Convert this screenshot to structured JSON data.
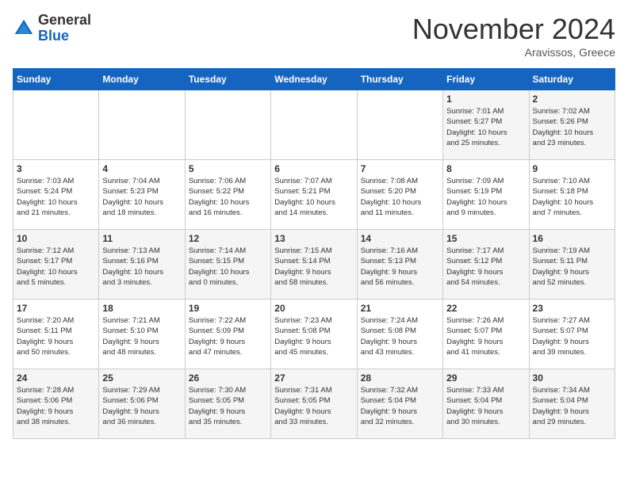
{
  "header": {
    "logo_general": "General",
    "logo_blue": "Blue",
    "month_title": "November 2024",
    "location": "Aravissos, Greece"
  },
  "weekdays": [
    "Sunday",
    "Monday",
    "Tuesday",
    "Wednesday",
    "Thursday",
    "Friday",
    "Saturday"
  ],
  "weeks": [
    [
      {
        "day": "",
        "info": ""
      },
      {
        "day": "",
        "info": ""
      },
      {
        "day": "",
        "info": ""
      },
      {
        "day": "",
        "info": ""
      },
      {
        "day": "",
        "info": ""
      },
      {
        "day": "1",
        "info": "Sunrise: 7:01 AM\nSunset: 5:27 PM\nDaylight: 10 hours\nand 25 minutes."
      },
      {
        "day": "2",
        "info": "Sunrise: 7:02 AM\nSunset: 5:26 PM\nDaylight: 10 hours\nand 23 minutes."
      }
    ],
    [
      {
        "day": "3",
        "info": "Sunrise: 7:03 AM\nSunset: 5:24 PM\nDaylight: 10 hours\nand 21 minutes."
      },
      {
        "day": "4",
        "info": "Sunrise: 7:04 AM\nSunset: 5:23 PM\nDaylight: 10 hours\nand 18 minutes."
      },
      {
        "day": "5",
        "info": "Sunrise: 7:06 AM\nSunset: 5:22 PM\nDaylight: 10 hours\nand 16 minutes."
      },
      {
        "day": "6",
        "info": "Sunrise: 7:07 AM\nSunset: 5:21 PM\nDaylight: 10 hours\nand 14 minutes."
      },
      {
        "day": "7",
        "info": "Sunrise: 7:08 AM\nSunset: 5:20 PM\nDaylight: 10 hours\nand 11 minutes."
      },
      {
        "day": "8",
        "info": "Sunrise: 7:09 AM\nSunset: 5:19 PM\nDaylight: 10 hours\nand 9 minutes."
      },
      {
        "day": "9",
        "info": "Sunrise: 7:10 AM\nSunset: 5:18 PM\nDaylight: 10 hours\nand 7 minutes."
      }
    ],
    [
      {
        "day": "10",
        "info": "Sunrise: 7:12 AM\nSunset: 5:17 PM\nDaylight: 10 hours\nand 5 minutes."
      },
      {
        "day": "11",
        "info": "Sunrise: 7:13 AM\nSunset: 5:16 PM\nDaylight: 10 hours\nand 3 minutes."
      },
      {
        "day": "12",
        "info": "Sunrise: 7:14 AM\nSunset: 5:15 PM\nDaylight: 10 hours\nand 0 minutes."
      },
      {
        "day": "13",
        "info": "Sunrise: 7:15 AM\nSunset: 5:14 PM\nDaylight: 9 hours\nand 58 minutes."
      },
      {
        "day": "14",
        "info": "Sunrise: 7:16 AM\nSunset: 5:13 PM\nDaylight: 9 hours\nand 56 minutes."
      },
      {
        "day": "15",
        "info": "Sunrise: 7:17 AM\nSunset: 5:12 PM\nDaylight: 9 hours\nand 54 minutes."
      },
      {
        "day": "16",
        "info": "Sunrise: 7:19 AM\nSunset: 5:11 PM\nDaylight: 9 hours\nand 52 minutes."
      }
    ],
    [
      {
        "day": "17",
        "info": "Sunrise: 7:20 AM\nSunset: 5:11 PM\nDaylight: 9 hours\nand 50 minutes."
      },
      {
        "day": "18",
        "info": "Sunrise: 7:21 AM\nSunset: 5:10 PM\nDaylight: 9 hours\nand 48 minutes."
      },
      {
        "day": "19",
        "info": "Sunrise: 7:22 AM\nSunset: 5:09 PM\nDaylight: 9 hours\nand 47 minutes."
      },
      {
        "day": "20",
        "info": "Sunrise: 7:23 AM\nSunset: 5:08 PM\nDaylight: 9 hours\nand 45 minutes."
      },
      {
        "day": "21",
        "info": "Sunrise: 7:24 AM\nSunset: 5:08 PM\nDaylight: 9 hours\nand 43 minutes."
      },
      {
        "day": "22",
        "info": "Sunrise: 7:26 AM\nSunset: 5:07 PM\nDaylight: 9 hours\nand 41 minutes."
      },
      {
        "day": "23",
        "info": "Sunrise: 7:27 AM\nSunset: 5:07 PM\nDaylight: 9 hours\nand 39 minutes."
      }
    ],
    [
      {
        "day": "24",
        "info": "Sunrise: 7:28 AM\nSunset: 5:06 PM\nDaylight: 9 hours\nand 38 minutes."
      },
      {
        "day": "25",
        "info": "Sunrise: 7:29 AM\nSunset: 5:06 PM\nDaylight: 9 hours\nand 36 minutes."
      },
      {
        "day": "26",
        "info": "Sunrise: 7:30 AM\nSunset: 5:05 PM\nDaylight: 9 hours\nand 35 minutes."
      },
      {
        "day": "27",
        "info": "Sunrise: 7:31 AM\nSunset: 5:05 PM\nDaylight: 9 hours\nand 33 minutes."
      },
      {
        "day": "28",
        "info": "Sunrise: 7:32 AM\nSunset: 5:04 PM\nDaylight: 9 hours\nand 32 minutes."
      },
      {
        "day": "29",
        "info": "Sunrise: 7:33 AM\nSunset: 5:04 PM\nDaylight: 9 hours\nand 30 minutes."
      },
      {
        "day": "30",
        "info": "Sunrise: 7:34 AM\nSunset: 5:04 PM\nDaylight: 9 hours\nand 29 minutes."
      }
    ]
  ]
}
